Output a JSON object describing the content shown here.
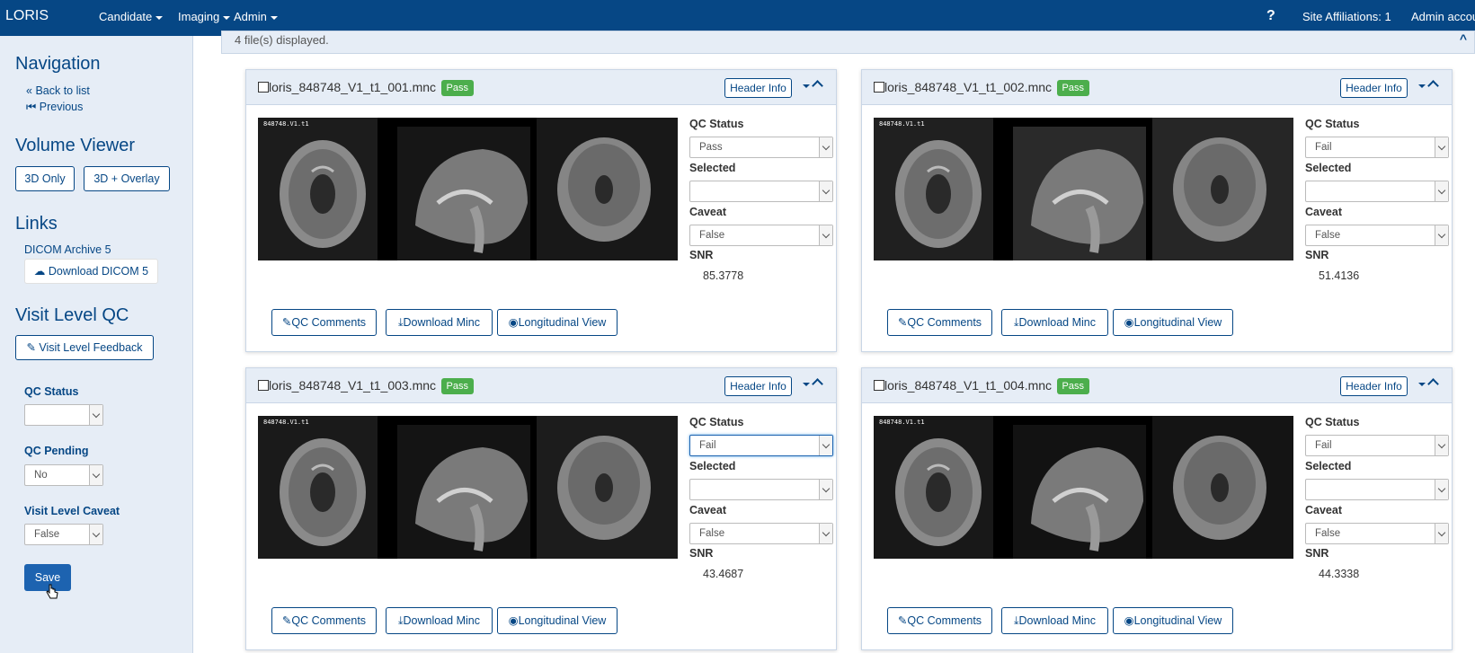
{
  "nav": {
    "brand": "LORIS",
    "menus": [
      "Candidate",
      "Imaging",
      "Admin"
    ],
    "help": "?",
    "site_affiliations": "Site Affiliations: 1",
    "account": "Admin accou"
  },
  "sidebar": {
    "navigation_title": "Navigation",
    "back_to_list": "Back to list",
    "previous": "Previous",
    "volume_viewer_title": "Volume Viewer",
    "btn_3d_only": "3D Only",
    "btn_3d_overlay": "3D + Overlay",
    "links_title": "Links",
    "dicom_archive": "DICOM Archive 5",
    "download_dicom": "Download DICOM 5",
    "visit_qc_title": "Visit Level QC",
    "visit_feedback": "Visit Level Feedback",
    "qc_status_label": "QC Status",
    "qc_status_value": "",
    "qc_pending_label": "QC Pending",
    "qc_pending_value": "No",
    "visit_caveat_label": "Visit Level Caveat",
    "visit_caveat_value": "False",
    "save": "Save"
  },
  "main": {
    "files_displayed": "4 file(s) displayed.",
    "close": "^"
  },
  "labels": {
    "header_info": "Header Info",
    "qc_status": "QC Status",
    "selected": "Selected",
    "caveat": "Caveat",
    "snr": "SNR",
    "qc_comments": "QC Comments",
    "download_minc": "Download Minc",
    "longitudinal_view": "Longitudinal View"
  },
  "panels": [
    {
      "filename": "loris_848748_V1_t1_001.mnc",
      "badge": "Pass",
      "image_tag": "848748.V1.t1",
      "qc_status": "Pass",
      "selected": "",
      "caveat": "False",
      "snr": "85.3778"
    },
    {
      "filename": "loris_848748_V1_t1_002.mnc",
      "badge": "Pass",
      "image_tag": "848748.V1.t1",
      "qc_status": "Fail",
      "selected": "",
      "caveat": "False",
      "snr": "51.4136"
    },
    {
      "filename": "loris_848748_V1_t1_003.mnc",
      "badge": "Pass",
      "image_tag": "848748.V1.t1",
      "qc_status": "Fail",
      "selected": "",
      "caveat": "False",
      "snr": "43.4687"
    },
    {
      "filename": "loris_848748_V1_t1_004.mnc",
      "badge": "Pass",
      "image_tag": "848748.V1.t1",
      "qc_status": "Fail",
      "selected": "",
      "caveat": "False",
      "snr": "44.3338"
    }
  ],
  "colors": {
    "nav": "#064785",
    "sidebar": "#e6edf6",
    "pass_badge": "#4cae4c",
    "save": "#1d63b0"
  }
}
